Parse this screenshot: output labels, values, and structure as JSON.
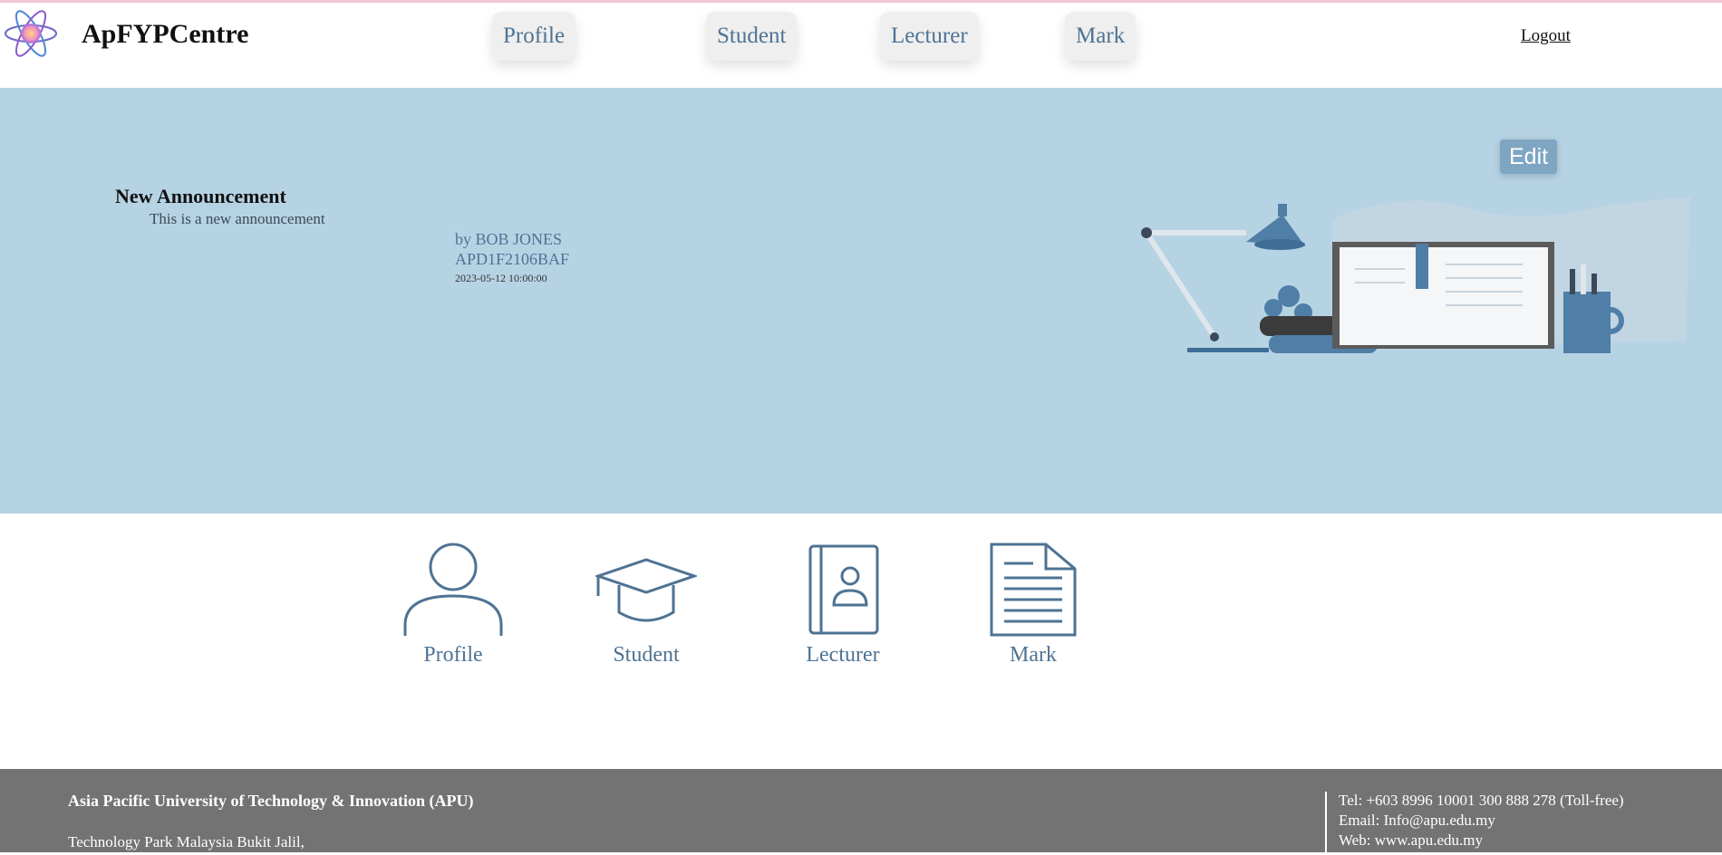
{
  "brand": {
    "name": "ApFYPCentre"
  },
  "nav": {
    "items": [
      {
        "label": "Profile"
      },
      {
        "label": "Student"
      },
      {
        "label": "Lecturer"
      },
      {
        "label": "Mark"
      }
    ],
    "logout_label": "Logout"
  },
  "announcement": {
    "title": "New Announcement",
    "body": "This is a new announcement",
    "author": "by BOB JONES",
    "code": "APD1F2106BAF",
    "datetime": "2023-05-12 10:00:00",
    "edit_label": "Edit"
  },
  "quick_links": [
    {
      "label": "Profile",
      "icon": "person-icon"
    },
    {
      "label": "Student",
      "icon": "graduation-cap-icon"
    },
    {
      "label": "Lecturer",
      "icon": "contact-book-icon"
    },
    {
      "label": "Mark",
      "icon": "document-icon"
    }
  ],
  "footer": {
    "university": "Asia Pacific University of Technology & Innovation (APU)",
    "address_line": "Technology Park Malaysia Bukit Jalil,",
    "tel": "Tel: +603 8996 10001 300 888 278 (Toll-free)",
    "email": "Email: Info@apu.edu.my",
    "web": "Web: www.apu.edu.my"
  },
  "colors": {
    "accent": "#4e7393",
    "hero_bg": "#b6d3e4",
    "footer_bg": "#737373",
    "edit_button": "#7ea6c3"
  }
}
